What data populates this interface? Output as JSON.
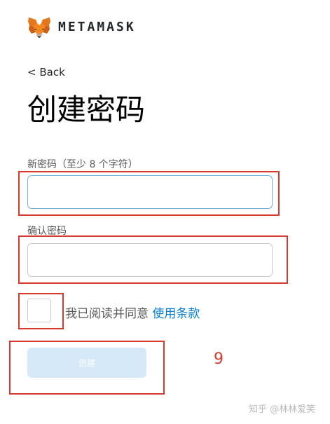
{
  "header": {
    "brand": "METAMASK",
    "logo_icon": "metamask-fox-icon"
  },
  "nav": {
    "back_label": "< Back"
  },
  "page": {
    "title": "创建密码"
  },
  "form": {
    "new_password_label": "新密码（至少 8 个字符）",
    "new_password_value": "",
    "confirm_password_label": "确认密码",
    "confirm_password_value": "",
    "agree_text": "我已阅读并同意",
    "terms_link": "使用条款",
    "create_button": "创建"
  },
  "annotations": {
    "number": "9",
    "watermark": "知乎 @林林爱笑"
  },
  "colors": {
    "accent": "#037dd6",
    "button_disabled": "#d6e9f8",
    "annotation_red": "#d63a2f"
  }
}
